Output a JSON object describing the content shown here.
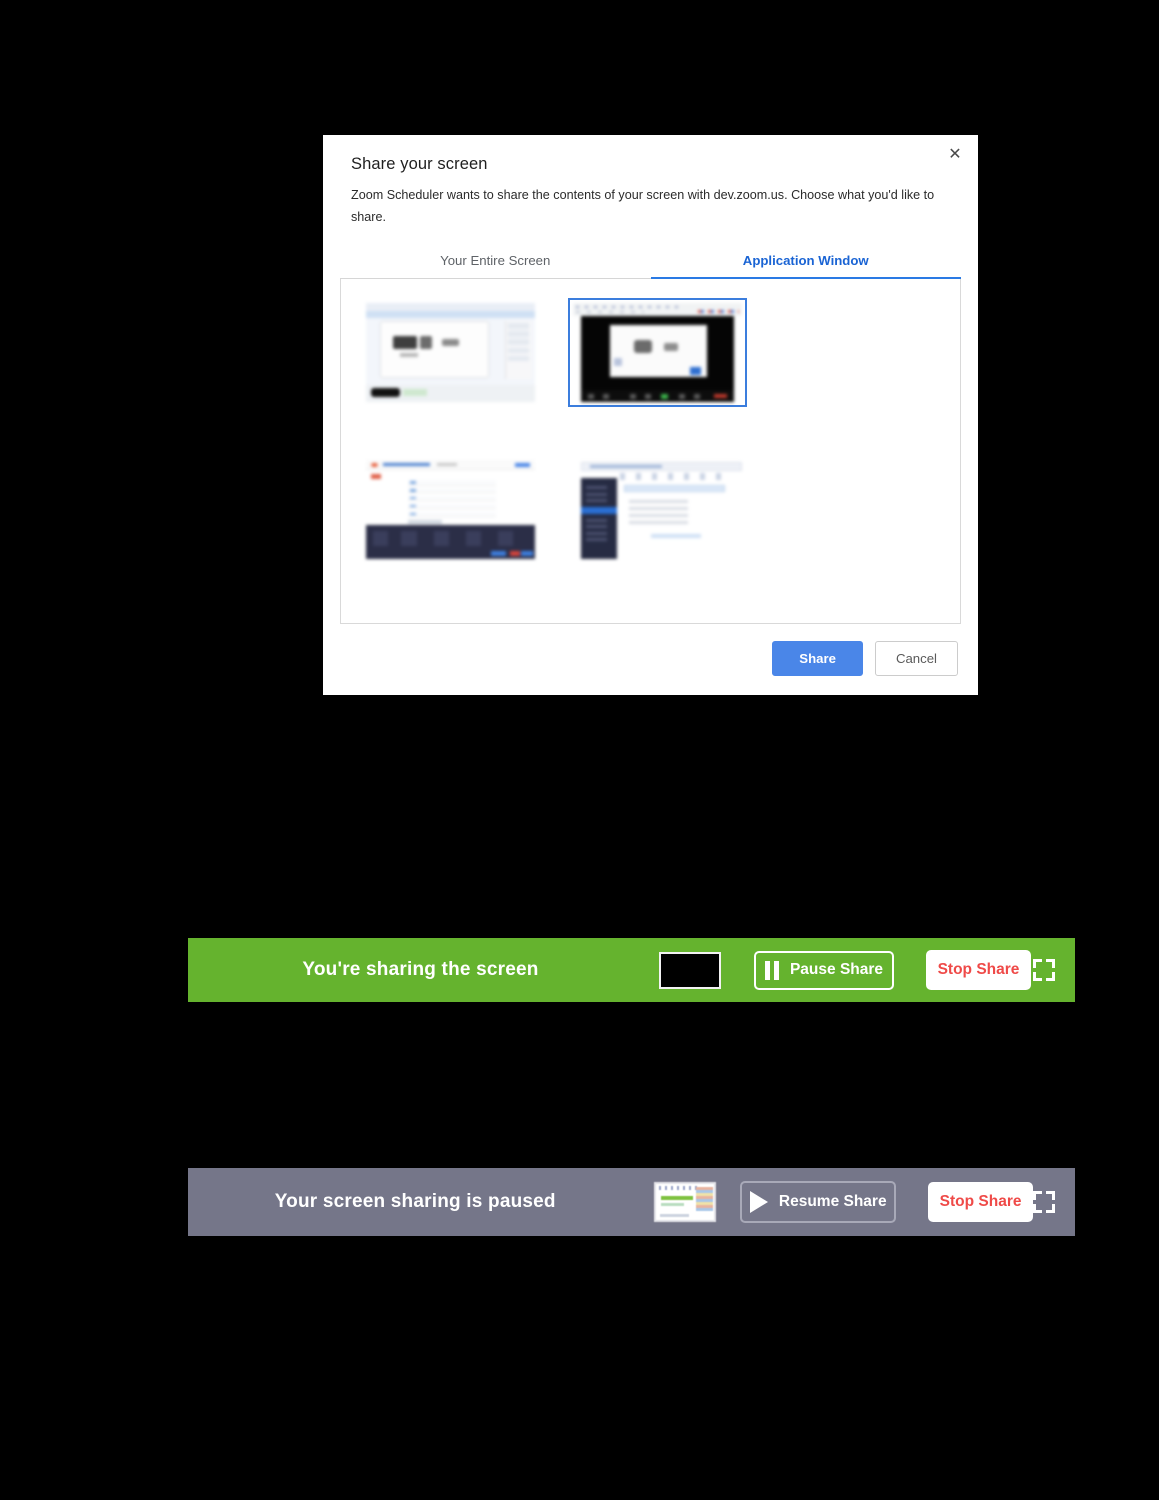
{
  "dialog": {
    "title": "Share your screen",
    "description": "Zoom Scheduler wants to share the contents of your screen with dev.zoom.us. Choose what you'd like to share.",
    "close_icon": "close-icon",
    "tabs": [
      {
        "label": "Your Entire Screen",
        "active": false
      },
      {
        "label": "Application Window",
        "active": true
      }
    ],
    "sources": [
      {
        "name": "presentation-window",
        "selected": false
      },
      {
        "name": "zoom-meeting-window",
        "selected": true
      },
      {
        "name": "web-page-window",
        "selected": false
      },
      {
        "name": "mail-client-window",
        "selected": false
      }
    ],
    "actions": {
      "share_label": "Share",
      "cancel_label": "Cancel"
    },
    "colors": {
      "accent": "#4a86e8",
      "tab_active": "#1a64d4",
      "border": "#d9d9d9"
    }
  },
  "sharing_bar": {
    "status_label": "You're sharing the screen",
    "thumbnail_name": "shared-window-thumbnail",
    "pause_label": "Pause Share",
    "pause_icon": "pause-icon",
    "stop_label": "Stop Share",
    "expand_icon": "expand-icon",
    "background": "#65b32e",
    "stop_color": "#ef4a48"
  },
  "paused_bar": {
    "status_label": "Your screen sharing is paused",
    "thumbnail_name": "paused-window-thumbnail",
    "resume_label": "Resume Share",
    "resume_icon": "play-icon",
    "stop_label": "Stop Share",
    "expand_icon": "expand-icon",
    "background": "#757689",
    "stop_color": "#ef4a48"
  }
}
